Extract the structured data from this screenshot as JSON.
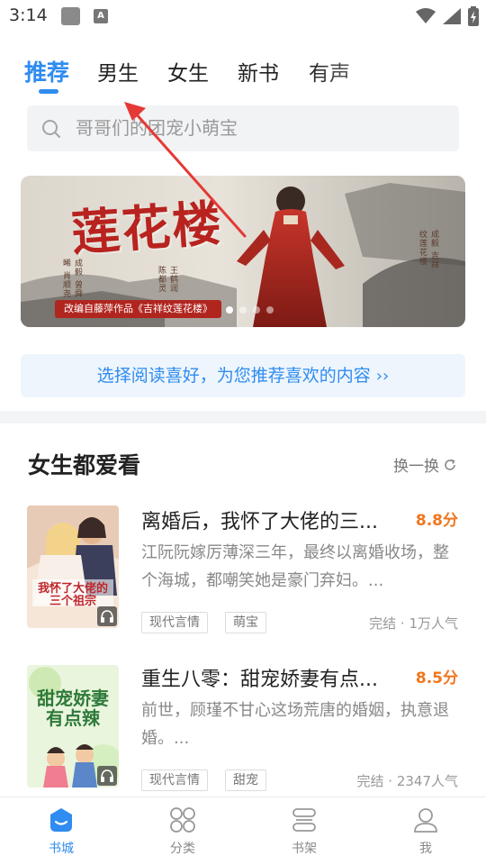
{
  "status_bar": {
    "time": "3:14",
    "a_icon": "A"
  },
  "tabs": [
    {
      "label": "推荐",
      "active": true
    },
    {
      "label": "男生"
    },
    {
      "label": "女生"
    },
    {
      "label": "新书"
    },
    {
      "label": "有声"
    }
  ],
  "search": {
    "placeholder": "哥哥们的团宠小萌宝"
  },
  "banner": {
    "title": "莲花楼",
    "caption": "改编自藤萍作品《吉祥纹莲花楼》",
    "credits_left": "成毅 曾舜晞 肖顺尧",
    "credits_mid": "王鹤润 陈都灵",
    "credits_right": "成毅 吉祥纹莲花楼",
    "slide_count": 4,
    "active_slide": 0
  },
  "preference": {
    "text": "选择阅读喜好，为您推荐喜欢的内容",
    "chevron": "››"
  },
  "section": {
    "title": "女生都爱看",
    "refresh_label": "换一换",
    "refresh_icon": "refresh-icon"
  },
  "books": [
    {
      "title": "离婚后，我怀了大佬的三...",
      "score": "8.8分",
      "desc": "江阮阮嫁厉薄深三年，最终以离婚收场，整个海城，都嘲笑她是豪门弃妇。...",
      "tags": [
        "现代言情",
        "萌宝"
      ],
      "meta": "完结 · 1万人气",
      "cover_text": "我怀了大佬的三个祖宗"
    },
    {
      "title": "重生八零：甜宠娇妻有点...",
      "score": "8.5分",
      "desc": "前世，顾瑾不甘心这场荒唐的婚姻，执意退婚。...",
      "tags": [
        "现代言情",
        "甜宠"
      ],
      "meta": "完结 · 2347人气",
      "cover_text": "甜宠娇妻有点辣"
    }
  ],
  "bottom_nav": [
    {
      "label": "书城",
      "icon": "bookstore-icon",
      "active": true
    },
    {
      "label": "分类",
      "icon": "category-icon"
    },
    {
      "label": "书架",
      "icon": "bookshelf-icon"
    },
    {
      "label": "我",
      "icon": "profile-icon"
    }
  ],
  "colors": {
    "accent": "#2f8cf0",
    "score": "#f0761e",
    "annotation_arrow": "#e53935"
  }
}
